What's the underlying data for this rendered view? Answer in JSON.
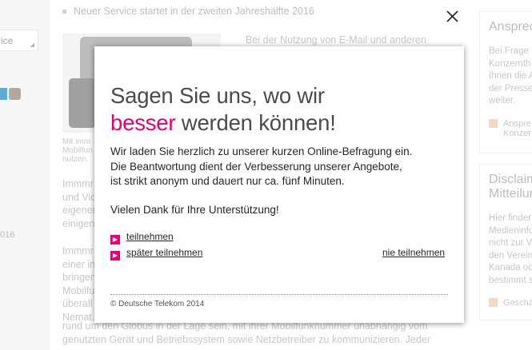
{
  "background": {
    "select_label": "ice",
    "left_date": "016",
    "bullet_text": "Neuer Service startet in der zweiten Jahreshälfte 2016",
    "image_caption": [
      "Mit imm",
      "Mobilfun",
      "nutzen."
    ],
    "col2_text": [
      "Bei der Nutzung von E-Mail und anderen"
    ],
    "para1": [
      "Immmr",
      "und Vid",
      "eigenen",
      "einigen"
    ],
    "para2": [
      "Immmr",
      "einer int",
      "bringen",
      "Mobilfun",
      "überall",
      "Nemat."
    ],
    "bottom_lines": [
      "rund um den Globus in der Lage sein, mit ihrer Mobilfunknummer unabhängig vom",
      "genutzten Gerät und Betriebssystem sowie Netzbetreiber zu kommunizieren. Jederzeit"
    ],
    "card1": {
      "title": "Ansprec",
      "body": [
        "Bei Frage",
        "Konzernth",
        "Ihnen die A",
        "der Presse",
        "weiter."
      ],
      "link": [
        "Anspre",
        "Konzer"
      ]
    },
    "card2": {
      "title": [
        "Disclaim",
        "Mitteilur"
      ],
      "body": [
        "Hier finder",
        "Medieninfo",
        "nicht zur V",
        "den Verein",
        "Kanada od",
        "bestimmt s"
      ],
      "link": "Geschä"
    }
  },
  "modal": {
    "heading_line1": "Sagen Sie uns, wo wir",
    "heading_accent": "besser",
    "heading_rest": " werden können!",
    "body_lines": [
      "Wir laden Sie herzlich zu unserer kurzen Online-Befragung ein.",
      "Die Beantwortung dient der Verbesserung unserer Angebote,",
      "ist strikt anonym und dauert nur ca. fünf Minuten."
    ],
    "thanks": "Vielen Dank für Ihre Unterstützung!",
    "link_join": "teilnehmen",
    "link_later": "später teilnehmen",
    "link_never": "nie teilnehmen",
    "footer": "© Deutsche Telekom 2014"
  },
  "colors": {
    "accent": "#e20074",
    "text": "#262626",
    "heading": "#4b4b4b"
  },
  "icons": {
    "close": "close-icon",
    "arrow": "arrow-right-icon"
  }
}
